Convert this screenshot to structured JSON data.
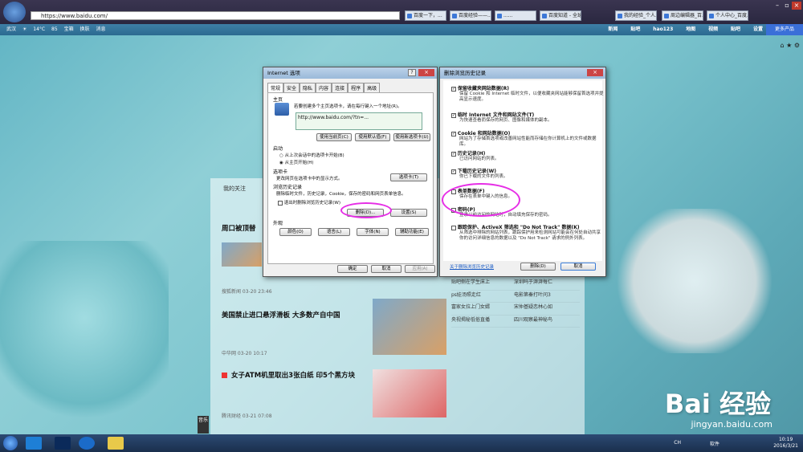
{
  "browser": {
    "url": "https://www.baidu.com/",
    "tabs": [
      "百度一下，...",
      "百度经验——...",
      "......",
      "百度知道 - 全球...",
      "我的经验_个人...",
      "周边编辑器_百...",
      "个人中心_百度..."
    ]
  },
  "navbar": {
    "weather": [
      "武汉",
      "14°C",
      "85",
      "宝箱",
      "换肤",
      "消息"
    ],
    "links": [
      "新闻",
      "贴吧",
      "地图",
      "视频",
      "贴吧",
      "hao123",
      "设置"
    ],
    "more": "更多产品"
  },
  "news": {
    "header": "我的关注",
    "items": [
      {
        "title": "周口被顶替",
        "meta": "搜狐新闻  03-20 23:46"
      },
      {
        "title": "美国禁止进口悬浮滑板 大多数产自中国",
        "meta": "中华网  03-20 10:17"
      },
      {
        "title": "女子ATM机里取出3张白纸 印5个黑方块",
        "meta": "腾讯财经  03-21 07:08"
      }
    ],
    "links": [
      [
        "贴吧侧在学生床上",
        "深圳吗于湃湃每仁"
      ],
      [
        "ps娃汤照走红",
        "电影第秦打叶问3"
      ],
      [
        "富家女拉上门女婿",
        "宋仲基疑恋林心如"
      ],
      [
        "央视揭秘低俗直播",
        "四川观察最神秘鸟"
      ]
    ],
    "side_label": "音乐"
  },
  "ie_options": {
    "title": "Internet 选项",
    "tabs": [
      "常规",
      "安全",
      "隐私",
      "内容",
      "连接",
      "程序",
      "高级"
    ],
    "home_group": "主页",
    "home_desc": "若要创建多个主页选项卡，请在每行键入一个地址(R)。",
    "home_url": "http://www.baidu.com/?tn=...",
    "home_btns": [
      "使用当前页(C)",
      "使用默认值(F)",
      "使用新选项卡(U)"
    ],
    "start_group": "启动",
    "start_opts": [
      "从上次会话中的选项卡开始(B)",
      "从主页开始(H)"
    ],
    "tabs_group": "选项卡",
    "tabs_desc": "更改网页在选项卡中的显示方式。",
    "tabs_btn": "选项卡(T)",
    "history_group": "浏览历史记录",
    "history_desc": "删除临时文件，历史记录，Cookie，保存的密码和网页表单信息。",
    "history_check": "退出时删除浏览历史记录(W)",
    "delete_btn": "删除(D)...",
    "settings_btn": "设置(S)",
    "appearance_group": "外观",
    "appearance_btns": [
      "颜色(O)",
      "语言(L)",
      "字体(N)",
      "辅助功能(E)"
    ],
    "footer_btns": [
      "确定",
      "取消",
      "应用(A)"
    ]
  },
  "delete_history": {
    "title": "删除浏览历史记录",
    "items": [
      {
        "title": "保留收藏夹网站数据(R)",
        "desc": "保留 Cookie 和 Internet 临时文件，以便收藏夹网站能够保留首选项并提高显示速度。",
        "checked": true
      },
      {
        "title": "临时 Internet 文件和网站文件(T)",
        "desc": "为快速查看而保存的网页、图像和媒体的副本。",
        "checked": true
      },
      {
        "title": "Cookie 和网站数据(O)",
        "desc": "网站为了存储首选项或改善网站性能而存储在你计算机上的文件或数据库。",
        "checked": true
      },
      {
        "title": "历史记录(H)",
        "desc": "已访问网站的列表。",
        "checked": true
      },
      {
        "title": "下载历史记录(W)",
        "desc": "你已下载的文件的列表。",
        "checked": true
      },
      {
        "title": "表单数据(F)",
        "desc": "保存在表单中键入的信息。",
        "checked": false
      },
      {
        "title": "密码(P)",
        "desc": "登录以前访问的网站时，自动填充保存的密码。",
        "checked": false
      },
      {
        "title": "跟踪保护、ActiveX 筛选和 \"Do Not Track\" 数据(K)",
        "desc": "从筛选中排除的网站列表，跟踪保护用来检测网站可能会在何处自动共享你的访问详细信息的数据以及 \"Do Not Track\" 请求的例外列表。",
        "checked": false
      }
    ],
    "link": "关于删除浏览历史记录",
    "buttons": [
      "删除(D)",
      "取消"
    ]
  },
  "taskbar": {
    "time": "10:19",
    "date": "2016/3/21",
    "ime": "CH",
    "sys_label": "软件"
  },
  "watermark": {
    "brand": "Bai 经验",
    "url": "jingyan.baidu.com"
  }
}
